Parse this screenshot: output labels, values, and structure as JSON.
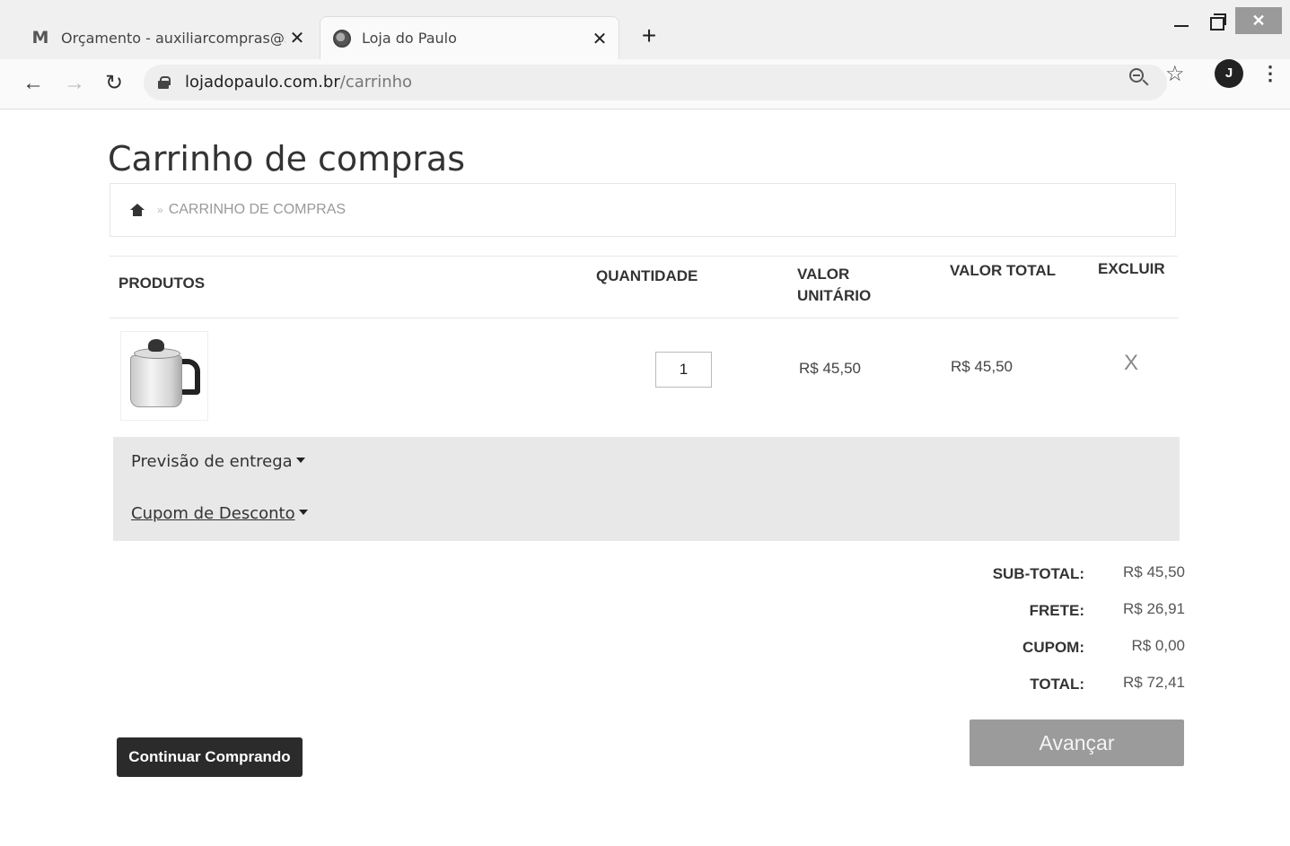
{
  "browser": {
    "tabs": [
      {
        "title": "Orçamento - auxiliarcompras@s",
        "icon": "gmail-icon",
        "close": "✕"
      },
      {
        "title": "Loja do Paulo",
        "icon": "globe-icon",
        "close": "✕"
      }
    ],
    "new_tab": "+",
    "url_domain": "lojadopaulo.com.br",
    "url_path": "/carrinho",
    "avatar_initial": "J",
    "window_close": "✕"
  },
  "page": {
    "title": "Carrinho de compras",
    "breadcrumb": {
      "separator": "»",
      "current": "CARRINHO DE COMPRAS"
    }
  },
  "cart": {
    "headers": {
      "produtos": "PRODUTOS",
      "quantidade": "QUANTIDADE",
      "valor_unitario": "VALOR UNITÁRIO",
      "valor_total": "VALOR TOTAL",
      "excluir": "EXCLUIR"
    },
    "items": [
      {
        "quantity": "1",
        "unit_price": "R$ 45,50",
        "total": "R$ 45,50",
        "delete": "X"
      }
    ]
  },
  "sections": {
    "entrega": "Previsão de entrega",
    "cupom": "Cupom de Desconto"
  },
  "totals": {
    "subtotal_label": "SUB-TOTAL:",
    "subtotal": "R$ 45,50",
    "frete_label": "FRETE:",
    "frete": "R$ 26,91",
    "cupom_label": "CUPOM:",
    "cupom": "R$ 0,00",
    "total_label": "TOTAL:",
    "total": "R$ 72,41"
  },
  "actions": {
    "continuar": "Continuar Comprando",
    "avancar": "Avançar"
  }
}
